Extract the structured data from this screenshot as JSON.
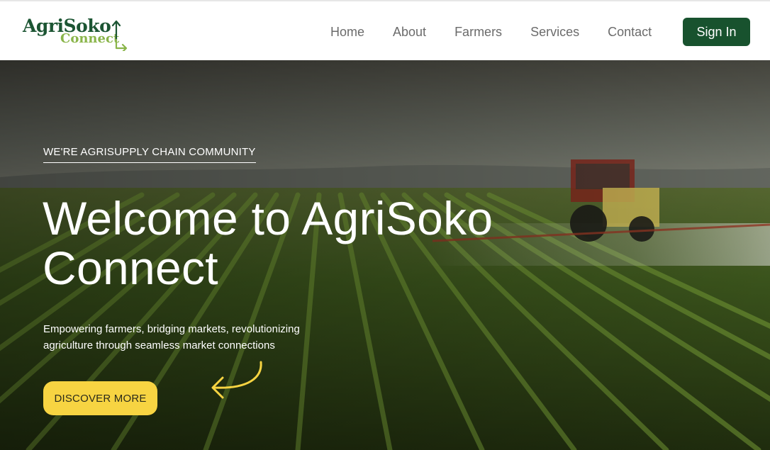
{
  "brand": {
    "name_line1": "AgriSoko",
    "name_line2": "Connect",
    "primary_color": "#1c5533",
    "secondary_color": "#8ab54a"
  },
  "nav": {
    "items": [
      {
        "label": "Home"
      },
      {
        "label": "About"
      },
      {
        "label": "Farmers"
      },
      {
        "label": "Services"
      },
      {
        "label": "Contact"
      }
    ],
    "signin_label": "Sign In",
    "signin_color": "#18522e"
  },
  "hero": {
    "tagline": "WE'RE AGRISUPPLY CHAIN COMMUNITY",
    "title": "Welcome to AgriSoko Connect",
    "subtitle": "Empowering farmers, bridging markets, revolutionizing agriculture through seamless market connections",
    "cta_label": "DISCOVER MORE",
    "cta_color": "#f7d442",
    "arrow_icon": "curved-arrow-left-icon",
    "arrow_color": "#f7d442"
  }
}
